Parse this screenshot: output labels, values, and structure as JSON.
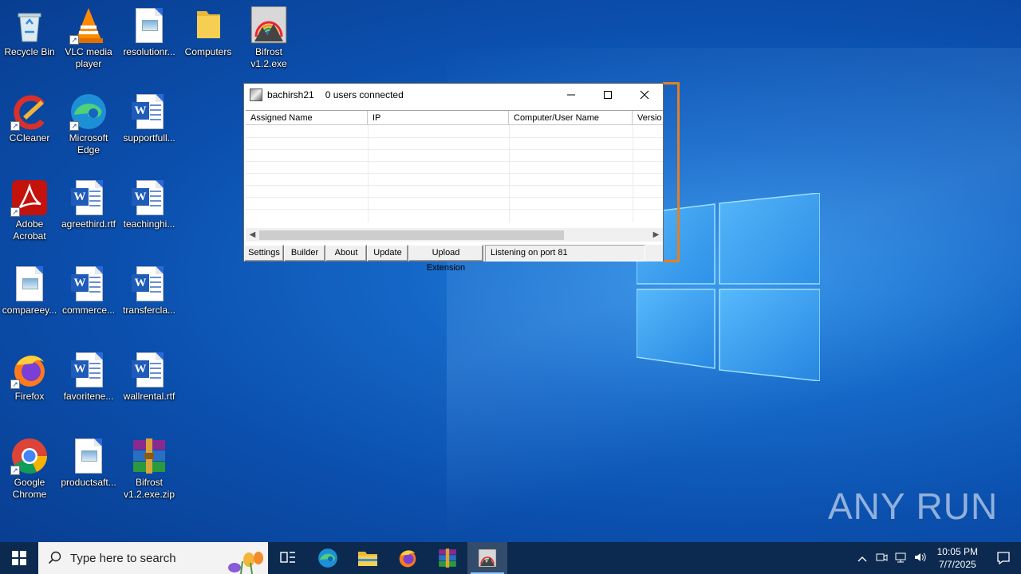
{
  "desktop": {
    "icons": [
      {
        "label": "Recycle Bin",
        "icon": "recycle-bin-icon"
      },
      {
        "label": "VLC media player",
        "icon": "vlc-icon"
      },
      {
        "label": "resolutionr...",
        "icon": "image-file-icon"
      },
      {
        "label": "Computers",
        "icon": "folder-icon"
      },
      {
        "label": "Bifrost v1.2.exe",
        "icon": "bifrost-exe-icon"
      },
      {
        "label": "CCleaner",
        "icon": "ccleaner-icon"
      },
      {
        "label": "Microsoft Edge",
        "icon": "edge-icon"
      },
      {
        "label": "supportfull...",
        "icon": "word-doc-icon"
      },
      {
        "label": "Adobe Acrobat",
        "icon": "acrobat-icon"
      },
      {
        "label": "agreethird.rtf",
        "icon": "word-doc-icon"
      },
      {
        "label": "teachinghi...",
        "icon": "word-doc-icon"
      },
      {
        "label": "compareey...",
        "icon": "image-file-icon"
      },
      {
        "label": "commerce...",
        "icon": "word-doc-icon"
      },
      {
        "label": "transfercla...",
        "icon": "word-doc-icon"
      },
      {
        "label": "Firefox",
        "icon": "firefox-icon"
      },
      {
        "label": "favoritene...",
        "icon": "word-doc-icon"
      },
      {
        "label": "wallrental.rtf",
        "icon": "word-doc-icon"
      },
      {
        "label": "Google Chrome",
        "icon": "chrome-icon"
      },
      {
        "label": "productsaft...",
        "icon": "image-file-icon"
      },
      {
        "label": "Bifrost v1.2.exe.zip",
        "icon": "winrar-archive-icon"
      }
    ]
  },
  "app": {
    "title": "bachirsh21",
    "users_status": "0 users connected",
    "columns": [
      "Assigned Name",
      "IP",
      "Computer/User Name",
      "Versio"
    ],
    "buttons": [
      "Settings",
      "Builder",
      "About",
      "Update",
      "Upload Extension"
    ],
    "status": "Listening on port 81",
    "outline_color": "#e67f22"
  },
  "watermark": "ANY RUN",
  "taskbar": {
    "search_placeholder": "Type here to search",
    "apps": [
      "task-view-icon",
      "edge-icon",
      "file-explorer-icon",
      "firefox-icon",
      "winrar-icon",
      "bifrost-icon"
    ],
    "time": "10:05 PM",
    "date": "7/7/2025"
  }
}
